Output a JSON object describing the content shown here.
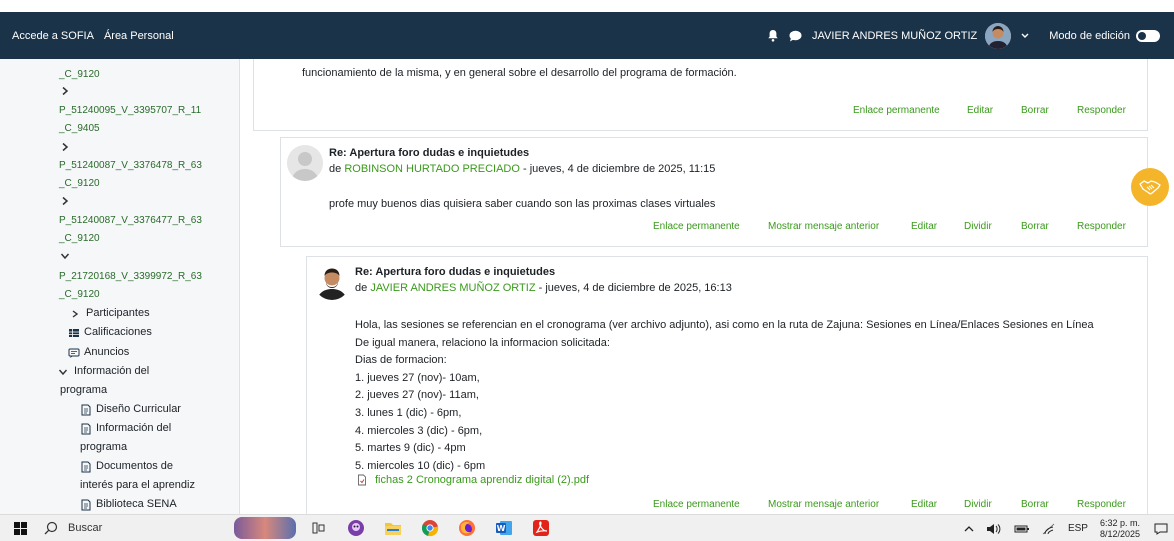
{
  "navbar": {
    "links": [
      "Accede a SOFIA",
      "Área Personal"
    ],
    "user_name": "JAVIER ANDRES MUÑOZ ORTIZ",
    "edit_mode_label": "Modo de edición",
    "edit_mode_on": false,
    "bg_color": "#1b3348"
  },
  "sidebar": {
    "course_codes": [
      {
        "line1": "_C_9120"
      },
      {
        "line1": "P_51240095_V_3395707_R_11",
        "line2": "_C_9405"
      },
      {
        "line1": "P_51240087_V_3376478_R_63",
        "line2": "_C_9120"
      },
      {
        "line1": "P_51240087_V_3376477_R_63",
        "line2": "_C_9120"
      },
      {
        "line1": "P_21720168_V_3399972_R_63",
        "line2": "_C_9120"
      }
    ],
    "participants": "Participantes",
    "grades": "Calificaciones",
    "announcements": "Anuncios",
    "program_info_line1": "Información del",
    "program_info_line2": "programa",
    "curricular_design": "Diseño Curricular",
    "program_info_sub_line1": "Información del",
    "program_info_sub_line2": "programa",
    "documents_line1": "Documentos de",
    "documents_line2": "interés para el aprendiz",
    "library": "Biblioteca SENA"
  },
  "forum": {
    "top_post_text": "funcionamiento de la misma, y en general sobre el desarrollo del programa de formación.",
    "top_actions": [
      "Enlace permanente",
      "Editar",
      "Borrar",
      "Responder"
    ],
    "reply1": {
      "title": "Re: Apertura foro dudas e inquietudes",
      "prefix": "de",
      "author": "ROBINSON HURTADO PRECIADO",
      "date": " - jueves, 4 de diciembre de 2025, 11:15",
      "message": "profe muy buenos dias quisiera saber cuando son las proximas clases virtuales",
      "actions": [
        "Enlace permanente",
        "Mostrar mensaje anterior",
        "Editar",
        "Dividir",
        "Borrar",
        "Responder"
      ]
    },
    "reply2": {
      "title": "Re: Apertura foro dudas e inquietudes",
      "prefix": "de",
      "author": "JAVIER ANDRES MUÑOZ ORTIZ",
      "date": " - jueves, 4 de diciembre de 2025, 16:13",
      "lines": [
        "Hola, las sesiones se referencian en el cronograma (ver archivo adjunto), asi como en la ruta de Zajuna: Sesiones en Línea/Enlaces Sesiones en Línea",
        "De igual manera, relaciono la informacion solicitada:",
        "Dias de formacion:",
        "1. jueves 27 (nov)- 10am,",
        "2. jueves 27 (nov)- 11am,",
        "3. lunes 1 (dic) - 6pm,",
        "4. miercoles 3 (dic) - 6pm,",
        "5. martes 9 (dic) - 4pm",
        "5. miercoles 10 (dic) - 6pm"
      ],
      "attachment": "fichas 2 Cronograma aprendiz digital (2).pdf",
      "actions": [
        "Enlace permanente",
        "Mostrar mensaje anterior",
        "Editar",
        "Dividir",
        "Borrar",
        "Responder"
      ]
    },
    "accent_color": "#3a9a1b"
  },
  "taskbar": {
    "search_label": "Buscar",
    "language": "ESP",
    "time": "6:32 p. m.",
    "date": "8/12/2025"
  }
}
